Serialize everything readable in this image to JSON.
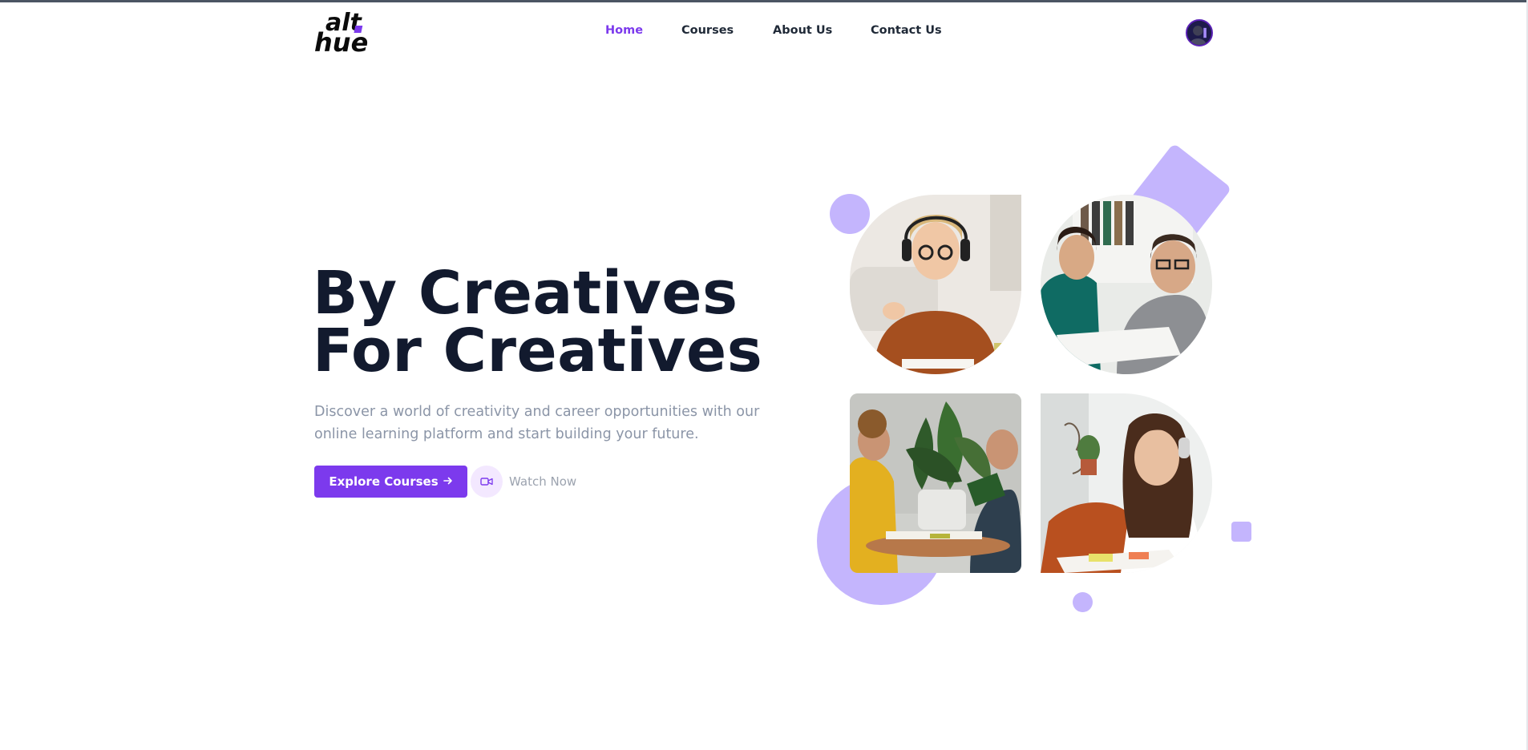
{
  "header": {
    "logo": {
      "line1": "alt",
      "line2": "hue",
      "accent": "#7c3aed"
    },
    "nav": [
      {
        "label": "Home",
        "active": true
      },
      {
        "label": "Courses",
        "active": false
      },
      {
        "label": "About Us",
        "active": false
      },
      {
        "label": "Contact Us",
        "active": false
      }
    ],
    "avatar_icon": "user-avatar"
  },
  "hero": {
    "title_line1": "By Creatives",
    "title_line2": "For Creatives",
    "description": "Discover a world of creativity and career opportunities with our online learning platform and start building your future.",
    "primary_button": "Explore Courses",
    "primary_button_icon": "arrow-right-icon",
    "secondary_button": "Watch Now",
    "secondary_button_icon": "video-camera-icon"
  },
  "gallery": {
    "photos": [
      {
        "subject": "woman-with-headphones-pointing"
      },
      {
        "subject": "two-people-reviewing-documents"
      },
      {
        "subject": "group-studying-around-plant"
      },
      {
        "subject": "smiling-woman-with-headphones-writing"
      }
    ]
  },
  "colors": {
    "accent": "#7c3aed",
    "decoration": "#c4b5fd",
    "heading": "#121a2e",
    "muted": "#8b95a7"
  }
}
